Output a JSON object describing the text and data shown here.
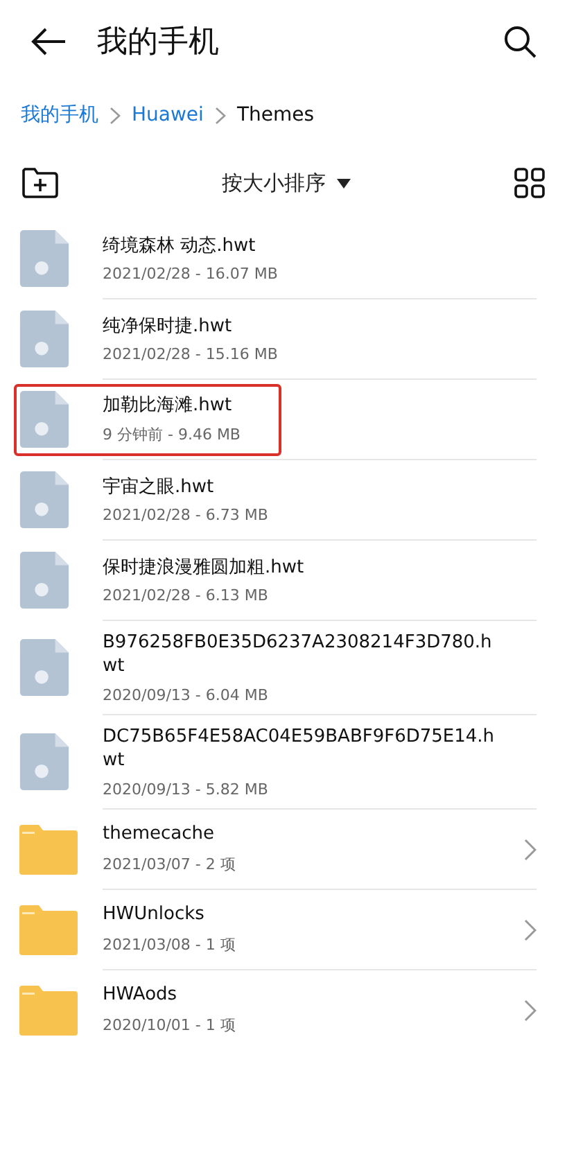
{
  "header": {
    "title": "我的手机"
  },
  "breadcrumb": [
    {
      "label": "我的手机",
      "current": false
    },
    {
      "label": "Huawei",
      "current": false
    },
    {
      "label": "Themes",
      "current": true
    }
  ],
  "toolbar": {
    "sort_label": "按大小排序"
  },
  "items": [
    {
      "kind": "file",
      "name": "绮境森林 动态.hwt",
      "meta": "2021/02/28 - 16.07 MB",
      "highlighted": false
    },
    {
      "kind": "file",
      "name": "纯净保时捷.hwt",
      "meta": "2021/02/28 - 15.16 MB",
      "highlighted": false
    },
    {
      "kind": "file",
      "name": "加勒比海滩.hwt",
      "meta": "9 分钟前 - 9.46 MB",
      "highlighted": true
    },
    {
      "kind": "file",
      "name": "宇宙之眼.hwt",
      "meta": "2021/02/28 - 6.73 MB",
      "highlighted": false
    },
    {
      "kind": "file",
      "name": "保时捷浪漫雅圆加粗.hwt",
      "meta": "2021/02/28 - 6.13 MB",
      "highlighted": false
    },
    {
      "kind": "file",
      "name": "B976258FB0E35D6237A2308214F3D780.hwt",
      "meta": "2020/09/13 - 6.04 MB",
      "highlighted": false
    },
    {
      "kind": "file",
      "name": "DC75B65F4E58AC04E59BABF9F6D75E14.hwt",
      "meta": "2020/09/13 - 5.82 MB",
      "highlighted": false
    },
    {
      "kind": "folder",
      "name": "themecache",
      "meta": "2021/03/07 - 2 项",
      "highlighted": false
    },
    {
      "kind": "folder",
      "name": "HWUnlocks",
      "meta": "2021/03/08 - 1 项",
      "highlighted": false
    },
    {
      "kind": "folder",
      "name": "HWAods",
      "meta": "2020/10/01 - 1 项",
      "highlighted": false
    }
  ]
}
